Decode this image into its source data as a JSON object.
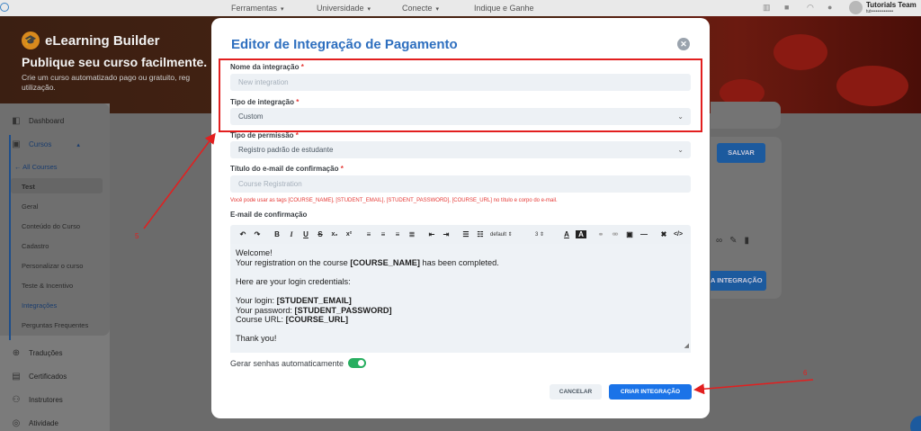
{
  "topnav": {
    "items": [
      {
        "label": "Ferramentas"
      },
      {
        "label": "Universidade"
      },
      {
        "label": "Conecte"
      },
      {
        "label": "Indique e Ganhe"
      }
    ],
    "user_name": "Tutorials Team",
    "user_email": "tut••••••••••••••"
  },
  "banner": {
    "brand": "eLearning Builder",
    "title": "Publique seu curso facilmente.",
    "description": "Crie um curso automatizado pago ou gratuito, reg utilização."
  },
  "sidebar": {
    "dashboard": "Dashboard",
    "cursos": "Cursos",
    "all_courses": "All Courses",
    "course_name": "Test",
    "sub_items": [
      "Geral",
      "Conteúdo do Curso",
      "Cadastro",
      "Personalizar o curso",
      "Teste & Incentivo",
      "Integrações",
      "Perguntas Frequentes"
    ],
    "bottom_items": [
      "Traduções",
      "Certificados",
      "Instrutores",
      "Atividade"
    ]
  },
  "background": {
    "save_label": "SALVAR",
    "integration_btn": "A INTEGRAÇÃO"
  },
  "modal": {
    "title": "Editor de Integração de Pagamento",
    "name_label": "Nome da integração",
    "name_placeholder": "New integration",
    "type_label": "Tipo de integração",
    "type_value": "Custom",
    "perm_label": "Tipo de permissão",
    "perm_value": "Registro padrão de estudante",
    "email_title_label": "Título do e-mail de confirmação",
    "email_title_placeholder": "Course Registration",
    "hint": "Você pode usar as tags [COURSE_NAME], [STUDENT_EMAIL], [STUDENT_PASSWORD], [COURSE_URL] no título e corpo do e-mail.",
    "email_label": "E-mail de confirmação",
    "toolbar": {
      "font": "default",
      "size": "3"
    },
    "body": {
      "l1": "Welcome!",
      "l2a": "Your registration on the course ",
      "l2b": "[COURSE_NAME]",
      "l2c": " has been completed.",
      "l3": "Here are your login credentials:",
      "l4a": "Your login: ",
      "l4b": "[STUDENT_EMAIL]",
      "l5a": "Your password: ",
      "l5b": "[STUDENT_PASSWORD]",
      "l6a": "Course URL: ",
      "l6b": "[COURSE_URL]",
      "l7": "Thank you!"
    },
    "toggle_label": "Gerar senhas automaticamente",
    "cancel": "CANCELAR",
    "create": "CRIAR INTEGRAÇÃO"
  },
  "annotations": {
    "a5": "5",
    "a6": "6"
  },
  "colors": {
    "accent": "#1a73e8",
    "annotation": "#e21f1f",
    "toggle_on": "#27ae60"
  }
}
